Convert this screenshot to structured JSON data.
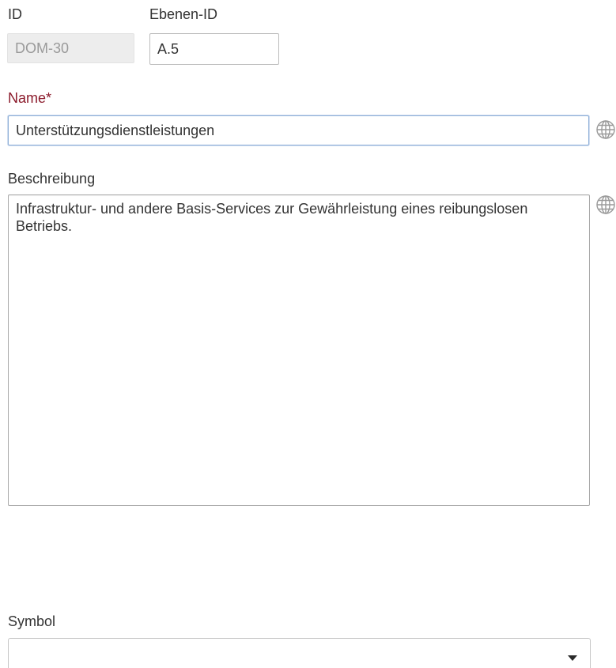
{
  "form": {
    "id": {
      "label": "ID",
      "value": "DOM-30"
    },
    "ebenen_id": {
      "label": "Ebenen-ID",
      "value": "A.5"
    },
    "name": {
      "label": "Name*",
      "value": "Unterstützungsdienstleistungen",
      "translate_icon": "globe-icon"
    },
    "beschreibung": {
      "label": "Beschreibung",
      "value": "Infrastruktur- und andere Basis-Services zur Gewährleistung eines reibungslosen Betriebs.",
      "translate_icon": "globe-icon"
    },
    "symbol": {
      "label": "Symbol",
      "value": "",
      "dropdown_icon": "caret-down-icon"
    }
  },
  "colors": {
    "required_label": "#8b1a2b",
    "focus_border": "#8fb0d8",
    "readonly_bg": "#ededed"
  }
}
